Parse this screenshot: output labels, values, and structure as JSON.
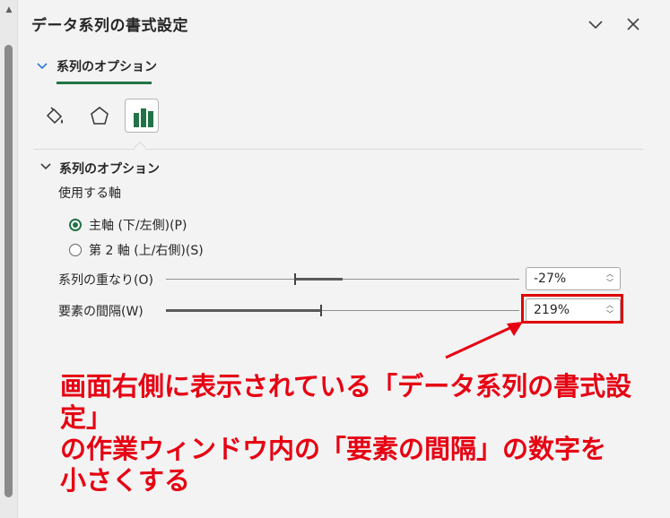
{
  "pane": {
    "title": "データ系列の書式設定",
    "dropdown_icon": "chevron-down-icon",
    "close_icon": "close-icon"
  },
  "options_tab": {
    "label": "系列のオプション"
  },
  "icon_tabs": [
    {
      "name": "fill-line-icon",
      "active": false
    },
    {
      "name": "effects-icon",
      "active": false
    },
    {
      "name": "series-options-icon",
      "active": true
    }
  ],
  "section": {
    "label": "系列のオプション",
    "axis_label": "使用する軸",
    "radios": [
      {
        "label": "主軸 (下/左側)(P)",
        "checked": true
      },
      {
        "label": "第 2 軸 (上/右側)(S)",
        "checked": false
      }
    ],
    "overlap": {
      "label": "系列の重なり(O)",
      "value": "-27%",
      "percent": -27
    },
    "gap": {
      "label": "要素の間隔(W)",
      "value": "219%",
      "percent": 219
    }
  },
  "annotation": {
    "line1": "画面右側に表示されている「データ系列の書式設定」",
    "line2": "の作業ウィンドウ内の「要素の間隔」の数字を",
    "line3": "小さくする",
    "color": "#e60012"
  },
  "colors": {
    "accent_green": "#217346",
    "annotation_red": "#e60012"
  }
}
